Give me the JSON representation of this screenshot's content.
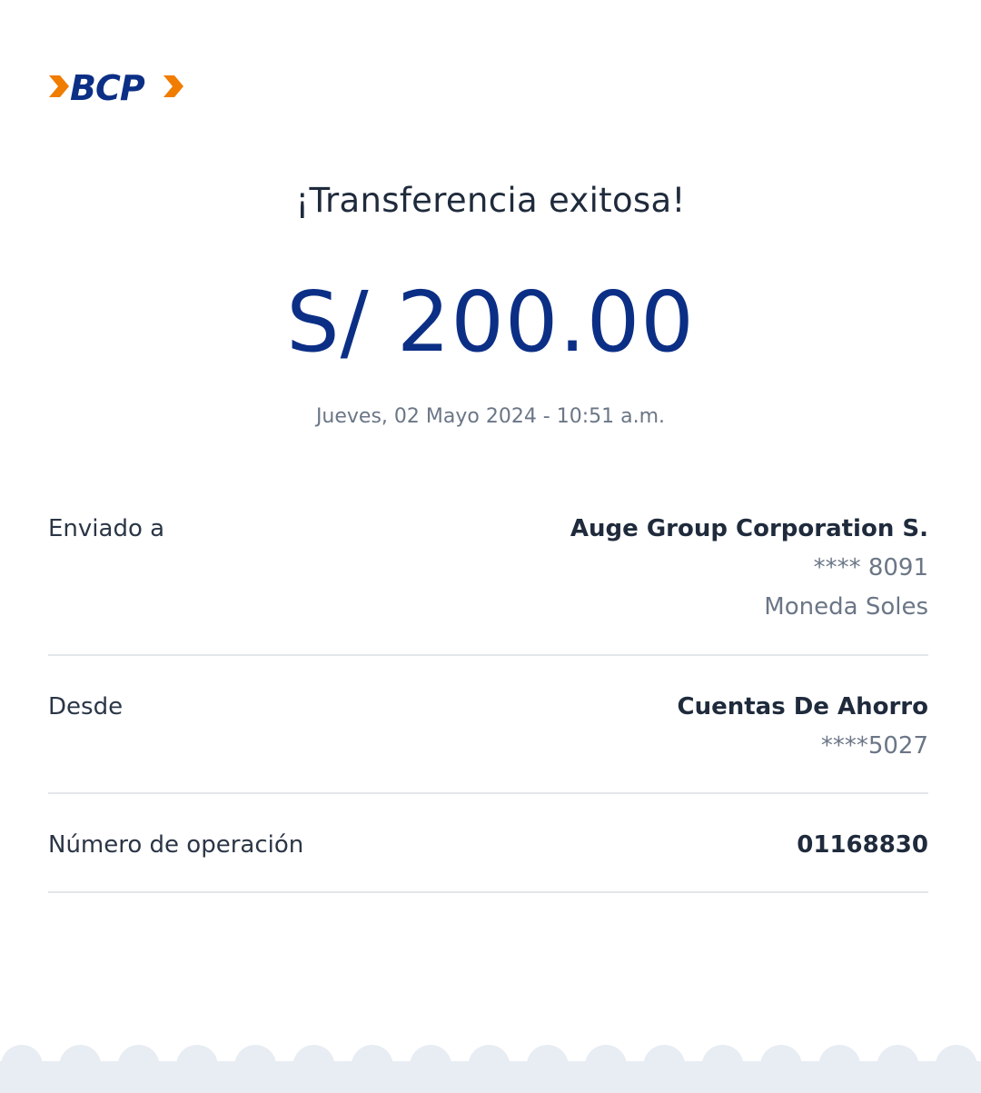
{
  "brand": {
    "logo_text": "BCP",
    "colors": {
      "blue": "#0c2f86",
      "orange": "#f07c00"
    }
  },
  "receipt": {
    "title": "¡Transferencia exitosa!",
    "amount": "S/ 200.00",
    "datetime": "Jueves, 02 Mayo 2024 - 10:51 a.m."
  },
  "details": {
    "sent_to": {
      "label": "Enviado a",
      "name": "Auge Group Corporation S.",
      "account": "**** 8091",
      "currency": "Moneda Soles"
    },
    "from": {
      "label": "Desde",
      "account_type": "Cuentas De Ahorro",
      "account": "****5027"
    },
    "operation": {
      "label": "Número de operación",
      "number": "01168830"
    }
  },
  "footer": {
    "edge_style": "scalloped",
    "color": "#e8ecf3"
  }
}
